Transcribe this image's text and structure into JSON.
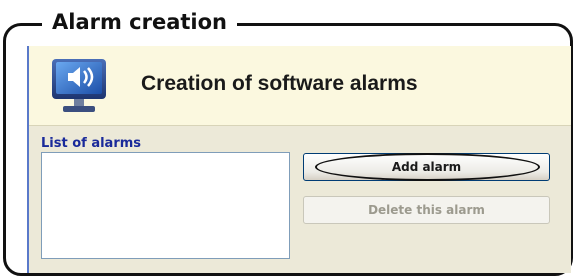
{
  "callout": {
    "title": "Alarm creation"
  },
  "window": {
    "header_title": "Creation of software alarms",
    "header_icon": "monitor-speaker-icon"
  },
  "alarms": {
    "list_label": "List of alarms",
    "items": []
  },
  "buttons": {
    "add_label": "Add alarm",
    "delete_label": "Delete this alarm",
    "delete_enabled": false
  },
  "colors": {
    "header_bg": "#fbf8df",
    "panel_bg": "#ece9d8",
    "label_blue": "#1a2a9a",
    "frame": "#111111"
  }
}
